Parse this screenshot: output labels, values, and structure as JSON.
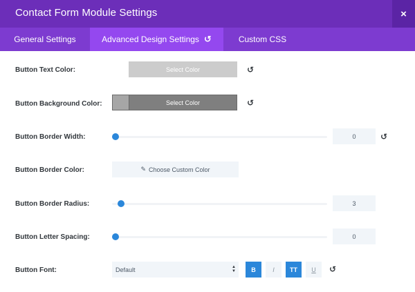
{
  "header": {
    "title": "Contact Form Module Settings",
    "close_label": "×"
  },
  "tabs": [
    {
      "label": "General Settings",
      "active": false
    },
    {
      "label": "Advanced Design Settings",
      "active": true,
      "reset_icon": "↺"
    },
    {
      "label": "Custom CSS",
      "active": false
    }
  ],
  "reset_glyph": "↺",
  "settings": {
    "text_color": {
      "label": "Button Text Color:",
      "button_label": "Select Color",
      "swatch": "#cccccc"
    },
    "bg_color": {
      "label": "Button Background Color:",
      "button_label": "Select Color",
      "swatch": "#7f7f7f"
    },
    "border_width": {
      "label": "Button Border Width:",
      "value": "0"
    },
    "border_color": {
      "label": "Button Border Color:",
      "button_label": "Choose Custom Color",
      "icon": "pencil-icon"
    },
    "border_radius": {
      "label": "Button Border Radius:",
      "value": "3"
    },
    "letter_spacing": {
      "label": "Button Letter Spacing:",
      "value": "0"
    },
    "font": {
      "label": "Button Font:",
      "selected": "Default",
      "bold": "B",
      "italic": "I",
      "uppercase": "TT",
      "underline": "U"
    }
  },
  "colors": {
    "header": "#6c2eb9",
    "tabs": "#7d3bd0",
    "active_tab": "#9448ef",
    "accent": "#2b87da"
  }
}
